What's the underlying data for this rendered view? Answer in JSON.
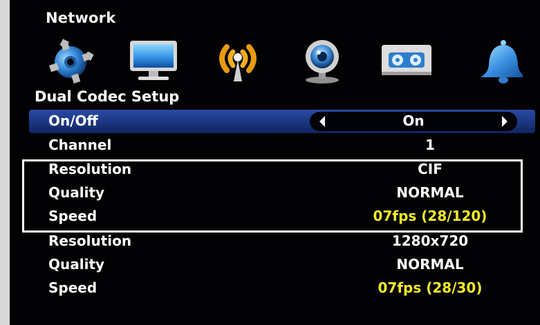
{
  "menu": {
    "title": "Network"
  },
  "icons": [
    "gear-icon",
    "monitor-icon",
    "network-signal-icon",
    "webcam-icon",
    "recorder-icon",
    "bell-icon"
  ],
  "section": {
    "title": "Dual Codec Setup"
  },
  "settings": {
    "on_off": {
      "label": "On/Off",
      "value": "On"
    },
    "channel": {
      "label": "Channel",
      "value": "1"
    },
    "resolution_1": {
      "label": "Resolution",
      "value": "CIF"
    },
    "quality_1": {
      "label": "Quality",
      "value": "NORMAL"
    },
    "speed_1": {
      "label": "Speed",
      "value": "07fps (28/120)"
    },
    "resolution_2": {
      "label": "Resolution",
      "value": "1280x720"
    },
    "quality_2": {
      "label": "Quality",
      "value": "NORMAL"
    },
    "speed_2": {
      "label": "Speed",
      "value": "07fps (28/30)"
    }
  },
  "colors": {
    "selected_row": "#1f3d93",
    "speed_text": "#f2ea28",
    "highlight_border": "#ffffff"
  }
}
